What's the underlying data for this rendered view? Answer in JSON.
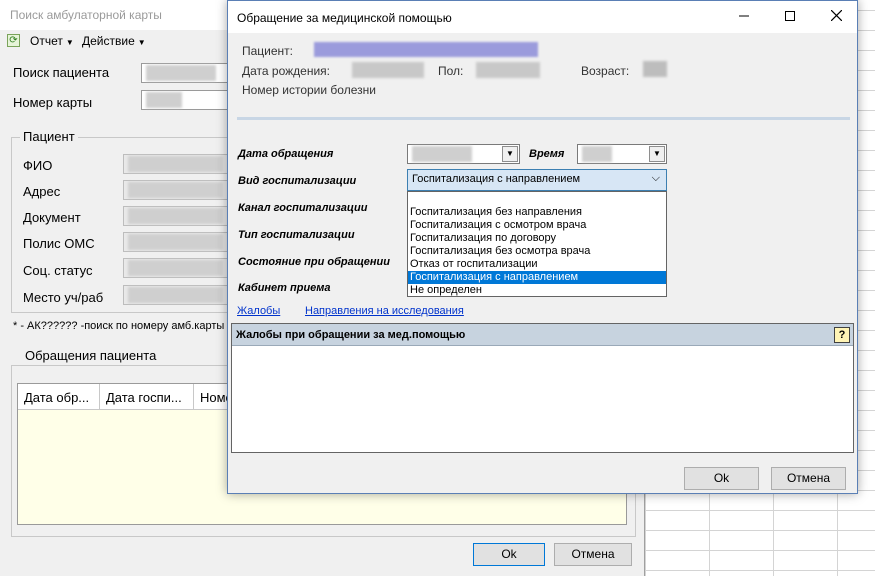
{
  "back_window": {
    "title": "Поиск амбулаторной карты",
    "menu": [
      {
        "label": "Отчет"
      },
      {
        "label": "Действие"
      }
    ],
    "search_label": "Поиск пациента",
    "card_label": "Номер карты",
    "patient_group": "Пациент",
    "fields": {
      "fio": "ФИО",
      "address": "Адрес",
      "document": "Документ",
      "oms": "Полис ОМС",
      "social": "Соц. статус",
      "place": "Место уч/раб"
    },
    "hint": "* - АК?????? -поиск по номеру амб.карты",
    "appeals_group": "Обращения пациента",
    "columns": [
      "Дата обр...",
      "Дата госпи...",
      "Номе"
    ],
    "ok": "Ok",
    "cancel": "Отмена"
  },
  "dialog": {
    "title": "Обращение за медицинской помощью",
    "patient_label": "Пациент:",
    "birth_label": "Дата рождения:",
    "sex_label": "Пол:",
    "age_label": "Возраст:",
    "history_label": "Номер истории болезни",
    "form": {
      "date_label": "Дата обращения",
      "time_label": "Время",
      "hosp_type_label": "Вид госпитализации",
      "channel_label": "Канал госпитализации",
      "type_label": "Тип госпитализации",
      "state_label": "Состояние при обращении",
      "room_label": "Кабинет приема"
    },
    "hosp_selected": "Госпитализация с направлением",
    "options": [
      "Госпитализация без направления",
      "Госпитализация с осмотром врача",
      "Госпитализация по договору",
      "Госпитализация без осмотра врача",
      "Отказ от госпитализации",
      "Госпитализация с направлением",
      "Не определен"
    ],
    "selected_index": 5,
    "link_complaints": "Жалобы",
    "link_directions": "Направления на исследования",
    "panel_title": "Жалобы при обращении за мед.помощью",
    "ok": "Ok",
    "cancel": "Отмена"
  },
  "colors": {
    "accent": "#0078d7",
    "patient_highlight": "#9b9bdc",
    "panel_header": "#c7d3df"
  }
}
